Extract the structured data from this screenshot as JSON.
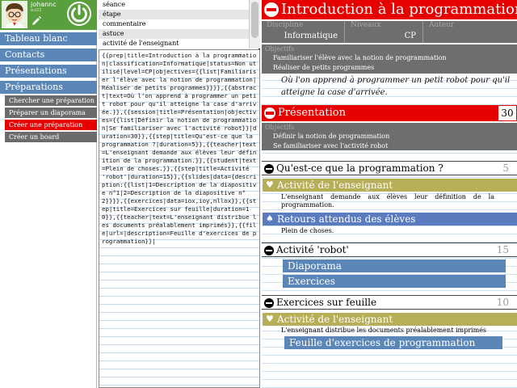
{
  "user": {
    "name": "johannc",
    "status": "ecl21"
  },
  "sidebar": {
    "items": [
      {
        "label": "Tableau blanc"
      },
      {
        "label": "Contacts"
      },
      {
        "label": "Présentations"
      },
      {
        "label": "Préparations"
      }
    ],
    "subitems": [
      {
        "label": "Chercher une préparation",
        "active": false
      },
      {
        "label": "Préparer un diaporama",
        "active": false
      },
      {
        "label": "Créer une préparation",
        "active": true
      },
      {
        "label": "Créer un board",
        "active": false
      }
    ]
  },
  "editor": {
    "types": [
      "séance",
      "étape",
      "commentaire",
      "astuce",
      "activité de l'enseignant"
    ],
    "code": "{{prep|title=Introduction à la programmation|classification=Informatique|status=Non utilisé|level=CP|objectives={{list|Familiariser l'élève avec la notion de programmation|Réaliser de petits programmes}}}},{{abstract|text=Où l'on apprend à programmer un petit robot pour qu'il atteigne la case d'arrivée.}},{{session|title=Présentation|objectives={{list|Définir la notion de programmation|Se familiariser avec l'activité robot}}|duration=30}},{{step|title=Qu'est-ce que la programmation ?|duration=5}},{{teacher|text=L'enseignant demande aux élèves leur définition de la programmation.}},{{student|text=Plein de choses.}},{{step|title=Activité 'robot'|duration=15}},{{slides|data={description:{{list|1=Description de la diapositive n°1|2=Description de la diapositive n°2}}}},{{exercices|data=iox,ioy,nllox}},{{step|title=Exercices sur feuille|duration=10}},{{teacher|text=L'enseignant distribue les documents préalablement imprimés}},{{file|url=|description=Feuille d'exercices de programmation}}|"
  },
  "preview": {
    "title": "Introduction à la programmation",
    "meta": [
      {
        "label": "Discipline",
        "value": "Informatique"
      },
      {
        "label": "Niveaux",
        "value": "CP"
      },
      {
        "label": "Auteur",
        "value": ""
      }
    ],
    "objectives_label": "Objectifs",
    "objectives": [
      "Familiariser l'élève avec la notion de programmation",
      "Réaliser de petits programmes"
    ],
    "abstract": "Où l'on apprend à programmer un petit robot pour qu'il atteigne la case d'arrivée.",
    "session": {
      "title": "Présentation",
      "duration": "30",
      "objectives_label": "Objectifs",
      "objectives": [
        "Définir la notion de programmation",
        "Se familiariser avec l'activité robot"
      ]
    },
    "steps": [
      {
        "title": "Qu'est-ce que la programmation ?",
        "duration": "5"
      },
      {
        "title": "Activité 'robot'",
        "duration": "15"
      },
      {
        "title": "Exercices sur feuille",
        "duration": "10"
      }
    ],
    "teacher_label": "Activité de l'enseignant",
    "student_label": "Retours attendus des élèves",
    "teacher1": "L'enseignant demande aux élèves leur définition de la programmation.",
    "student1": "Plein de choses.",
    "slides_label": "Diaporama",
    "exercices_label": "Exercices",
    "teacher2": "L'enseignant distribue les documents préalablement imprimés",
    "file_label": "Feuille d'exercices de programmation"
  },
  "colors": {
    "accent_red": "#e60000",
    "nav_blue": "#5b87b8",
    "user_green": "#5a9f3d",
    "teacher_olive": "#b7ae58",
    "student_blue": "#5b7bbf"
  }
}
